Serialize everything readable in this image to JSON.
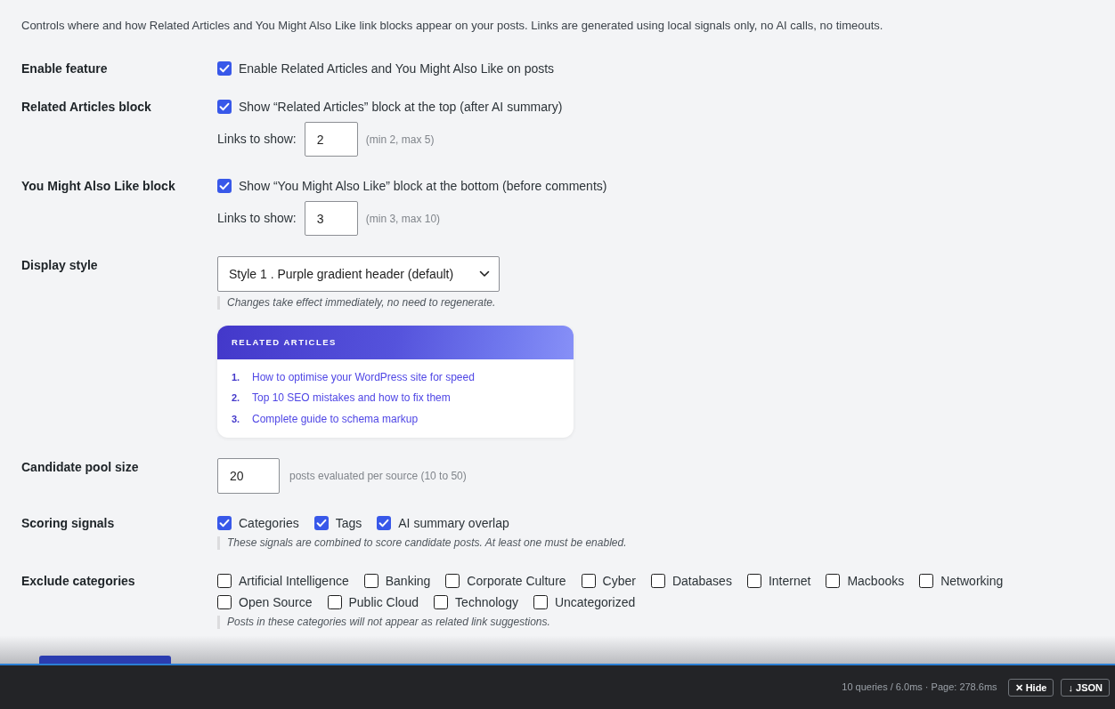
{
  "intro": "Controls where and how Related Articles and You Might Also Like link blocks appear on your posts. Links are generated using local signals only, no AI calls, no timeouts.",
  "settings": [
    {
      "kind": "checkbox",
      "label": "Enable feature",
      "option": {
        "label": "Enable Related Articles and You Might Also Like on posts",
        "checked": true
      }
    },
    {
      "kind": "block",
      "label": "Related Articles block",
      "option": {
        "label": "Show “Related Articles” block at the top (after AI summary)",
        "checked": true
      },
      "count": {
        "label": "Links to show:",
        "value": "2",
        "hint": "(min 2, max 5)"
      }
    },
    {
      "kind": "block",
      "label": "You Might Also Like block",
      "option": {
        "label": "Show “You Might Also Like” block at the bottom (before comments)",
        "checked": true
      },
      "count": {
        "label": "Links to show:",
        "value": "3",
        "hint": "(min 3, max 10)"
      }
    },
    {
      "kind": "select",
      "label": "Display style",
      "value": "Style 1 . Purple gradient header (default)",
      "note": "Changes take effect immediately, no need to regenerate.",
      "preview": {
        "title": "RELATED ARTICLES",
        "items": [
          {
            "number": "1.",
            "title": "How to optimise your WordPress site for speed"
          },
          {
            "number": "2.",
            "title": "Top 10 SEO mistakes and how to fix them"
          },
          {
            "number": "3.",
            "title": "Complete guide to schema markup"
          }
        ]
      }
    },
    {
      "kind": "number",
      "label": "Candidate pool size",
      "value": "20",
      "hint": "posts evaluated per source (10 to 50)"
    },
    {
      "kind": "checkgroup",
      "label": "Scoring signals",
      "options": [
        {
          "label": "Categories",
          "checked": true
        },
        {
          "label": "Tags",
          "checked": true
        },
        {
          "label": "AI summary overlap",
          "checked": true
        }
      ],
      "note": "These signals are combined to score candidate posts. At least one must be enabled."
    },
    {
      "kind": "checkgroup",
      "label": "Exclude categories",
      "options": [
        {
          "label": "Artificial Intelligence",
          "checked": false
        },
        {
          "label": "Banking",
          "checked": false
        },
        {
          "label": "Corporate Culture",
          "checked": false
        },
        {
          "label": "Cyber",
          "checked": false
        },
        {
          "label": "Databases",
          "checked": false
        },
        {
          "label": "Internet",
          "checked": false
        },
        {
          "label": "Macbooks",
          "checked": false
        },
        {
          "label": "Networking",
          "checked": false
        },
        {
          "label": "Open Source",
          "checked": false
        },
        {
          "label": "Public Cloud",
          "checked": false
        },
        {
          "label": "Technology",
          "checked": false
        },
        {
          "label": "Uncategorized",
          "checked": false
        }
      ],
      "note": "Posts in these categories will not appear as related link suggestions."
    }
  ],
  "debug_bar": {
    "stats": "10 queries / 6.0ms · Page: 278.6ms",
    "buttons": [
      {
        "icon": "✕",
        "label": "Hide"
      },
      {
        "icon": "↓",
        "label": "JSON"
      }
    ]
  }
}
